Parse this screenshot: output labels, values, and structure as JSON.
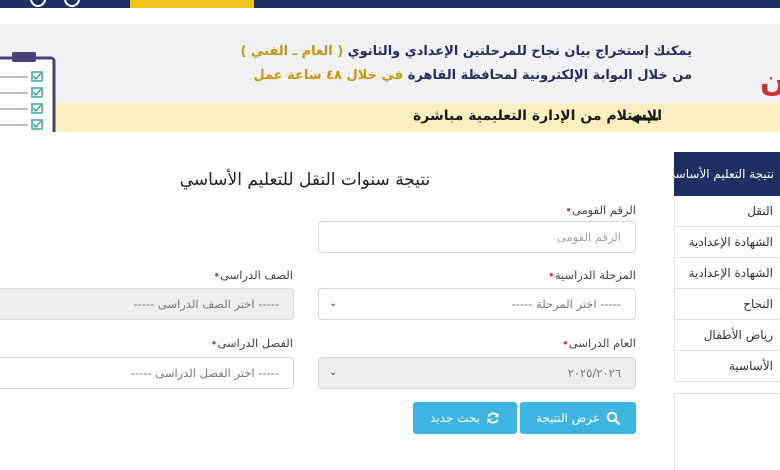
{
  "banner": {
    "line1_main": "يمكنك إستخراج بيان نجاح للمرحلتين الإعدادي والثانوي",
    "line1_highlight": "( العام ـ الفني )",
    "line2_main": "من خلال البوابة الإلكترونية لمحافظة القاهرة",
    "line2_highlight": "في خلال ٤٨ ساعة عمل",
    "line3": "الإستلام من الإدارة التعليمية مباشرة",
    "logo_fragment": "ن"
  },
  "sidebar": {
    "header": "نتيجة التعليم الأساسي",
    "items": [
      {
        "label": "النقل"
      },
      {
        "label": "الشهادة الإعدادية"
      },
      {
        "label": "الشهادة الإعدادية"
      },
      {
        "label": "النجاح"
      },
      {
        "label": "رياض الأطفال"
      },
      {
        "label": "الأساسية"
      }
    ]
  },
  "form": {
    "title": "نتيجة سنوات النقل للتعليم الأساسي",
    "national_id": {
      "label": "الرقم القومى",
      "placeholder": "الرقم القومى"
    },
    "stage": {
      "label": "المرحلة الدراسية",
      "value": "----- اختر المرحلة -----"
    },
    "grade": {
      "label": "الصف الدراسى",
      "value": "----- اختر الصف الدراسى -----"
    },
    "year": {
      "label": "العام الدراسى",
      "value": "٢٠٢٥/٢٠٢٦"
    },
    "term": {
      "label": "الفصل الدراسى",
      "value": "----- اختر الفصل الدراسى -----"
    },
    "show_result_label": "عرض النتيجة",
    "new_search_label": "بحث جديد",
    "required_mark": "•"
  },
  "colors": {
    "navy": "#1f2f63",
    "accent_yellow": "#f2c318",
    "button_blue": "#3db5e0",
    "required_red": "#d33333"
  },
  "icons": [
    "search-icon",
    "refresh-icon",
    "arrow-left-icon",
    "clipboard-checklist-icon",
    "chevron-down-icon"
  ]
}
